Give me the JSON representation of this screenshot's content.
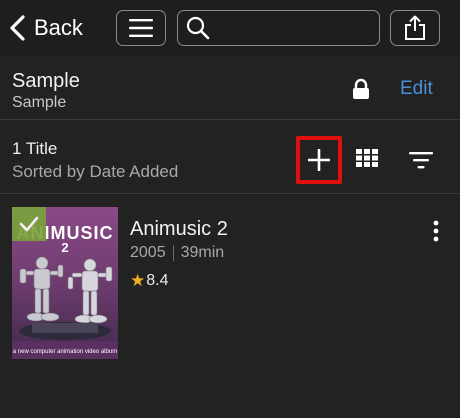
{
  "topbar": {
    "back_label": "Back",
    "search_placeholder": "",
    "icons": [
      "chevron-left-icon",
      "hamburger-menu-icon",
      "search-icon",
      "share-icon"
    ]
  },
  "library": {
    "name": "Sample",
    "subtitle": "Sample",
    "edit_label": "Edit",
    "lock_icon": "lock-icon"
  },
  "toolbar": {
    "count_label": "1 Title",
    "sort_label": "Sorted by Date Added",
    "icons": [
      "plus-icon",
      "grid-view-icon",
      "filter-icon"
    ],
    "highlight_color": "#e01010"
  },
  "items": [
    {
      "title": "Animusic 2",
      "year": "2005",
      "duration": "39min",
      "rating": "8.4",
      "poster": {
        "title_text": "ANIMUSIC",
        "number_text": "2",
        "caption": "a new computer animation video album",
        "watched": true
      }
    }
  ],
  "colors": {
    "background": "#222222",
    "accent_link": "#4a90d9",
    "star": "#f1b21f",
    "watched_badge": "#7aa33a"
  }
}
